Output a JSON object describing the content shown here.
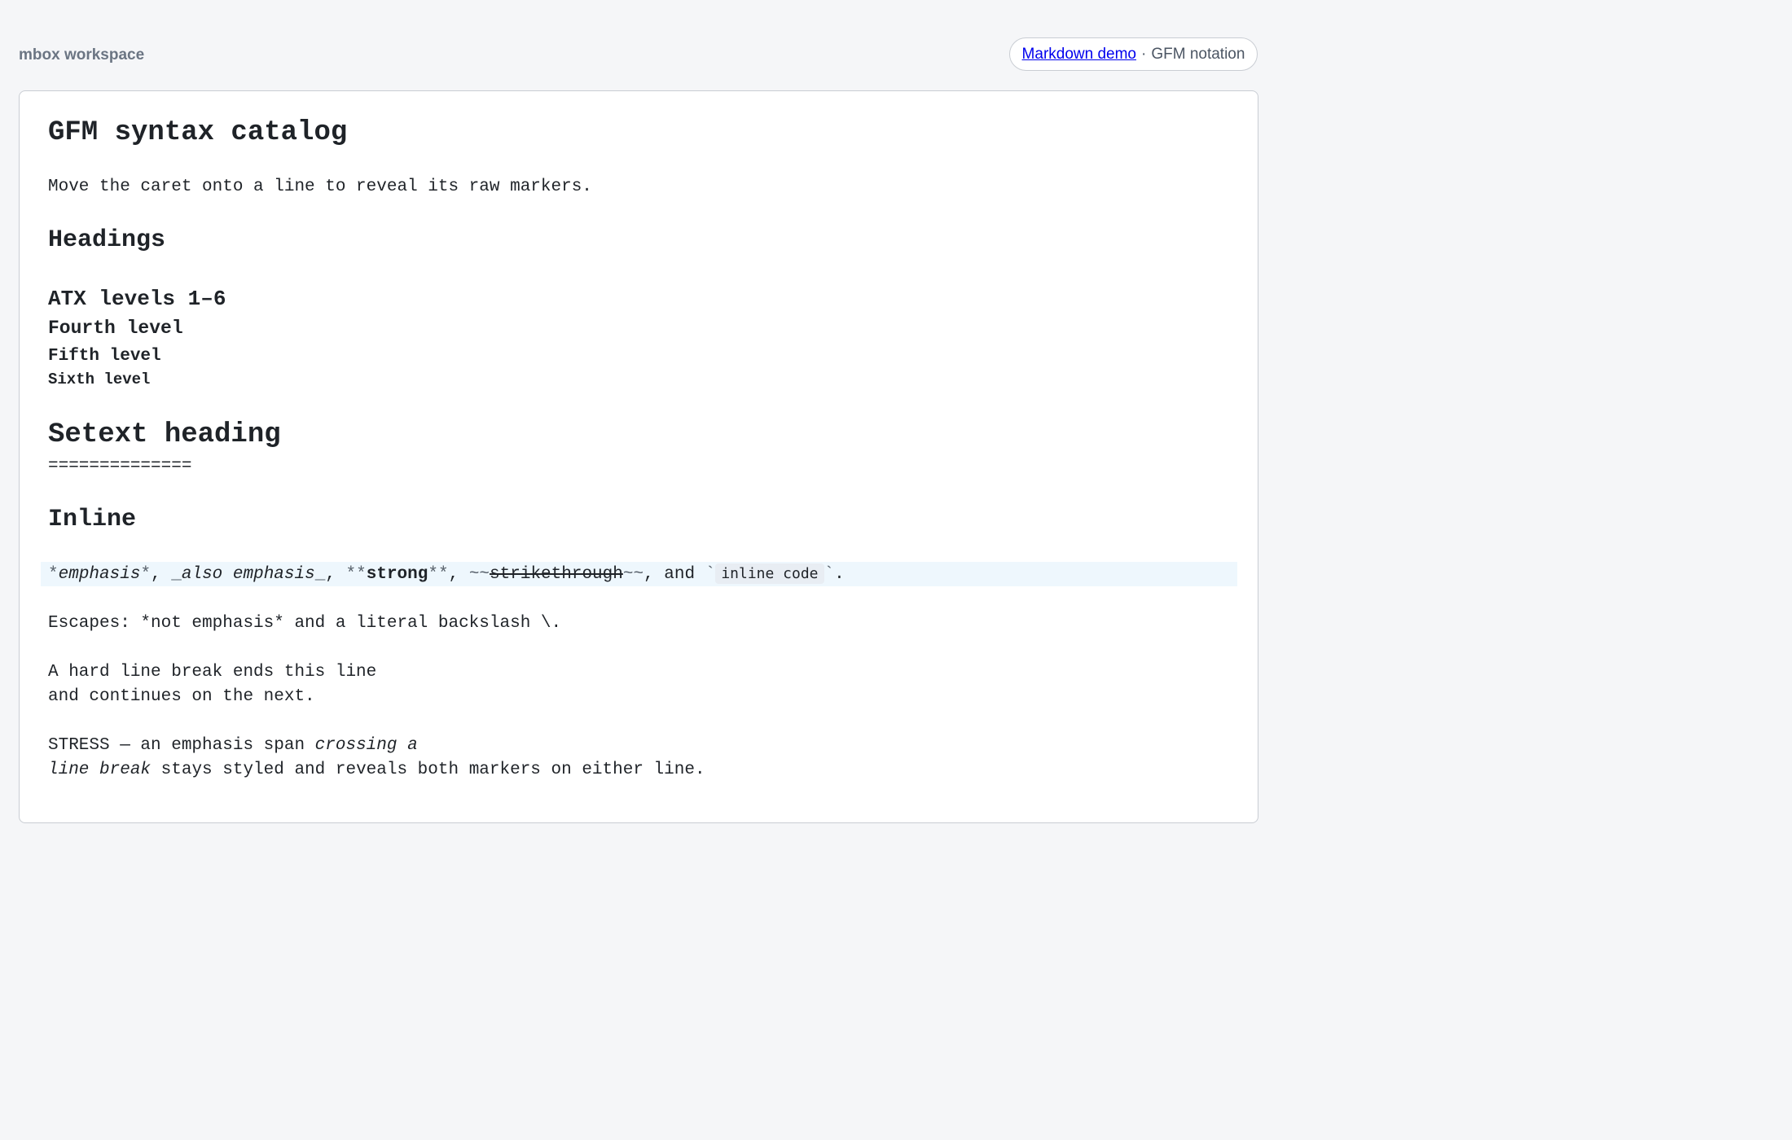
{
  "header": {
    "workspace": "mbox workspace",
    "demo_link": "Markdown demo",
    "separator": "·",
    "notation": "GFM notation"
  },
  "doc": {
    "title": "GFM syntax catalog",
    "intro": "Move the caret onto a line to reveal its raw markers.",
    "h_headings": "Headings",
    "h3": "ATX levels 1–6",
    "h4": "Fourth level",
    "h5": "Fifth level",
    "h6": "Sixth level",
    "setext_title": "Setext heading",
    "setext_underline": "==============",
    "h_inline": "Inline",
    "inline": {
      "m1": "*",
      "emphasis": "emphasis",
      "m2": "*",
      "t1": ", ",
      "m3": "_",
      "also": "also emphasis",
      "m4": "_",
      "t2": ", ",
      "m5": "**",
      "strong": "strong",
      "m6": "**",
      "t3": ", ",
      "m7": "~~",
      "strike": "strikethrough",
      "m8": "~~",
      "t4": ", and ",
      "m9": "`",
      "code": "inline code",
      "m10": "`",
      "t5": "."
    },
    "escapes": "Escapes: *not emphasis* and a literal backslash \\.",
    "hard1": "A hard line break ends this line",
    "hard2": "and continues on the next.",
    "stress1_plain": "STRESS — an emphasis span ",
    "stress1_em": "crossing a",
    "stress2_em": "line break",
    "stress2_plain": " stays styled and reveals both markers on either line."
  }
}
